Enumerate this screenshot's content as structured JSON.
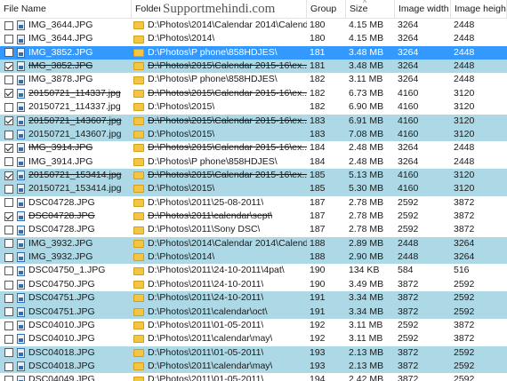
{
  "watermark": "Supportmehindi.com",
  "columns": {
    "name": "File Name",
    "folder": "Folder",
    "group": "Group",
    "size": "Size",
    "width": "Image width",
    "height": "Image height"
  },
  "sort_indicator": "^",
  "rows": [
    {
      "name": "IMG_3644.JPG",
      "folder": "D:\\Photos\\2014\\Calendar 2014\\Calendar...",
      "group": "180",
      "size": "4.15 MB",
      "width": "3264",
      "height": "2448",
      "checked": false,
      "strike": false,
      "style": "plain"
    },
    {
      "name": "IMG_3644.JPG",
      "folder": "D:\\Photos\\2014\\",
      "group": "180",
      "size": "4.15 MB",
      "width": "3264",
      "height": "2448",
      "checked": false,
      "strike": false,
      "style": "plain"
    },
    {
      "name": "IMG_3852.JPG",
      "folder": "D:\\Photos\\P phone\\858HDJES\\",
      "group": "181",
      "size": "3.48 MB",
      "width": "3264",
      "height": "2448",
      "checked": false,
      "strike": false,
      "style": "sel"
    },
    {
      "name": "IMG_3852.JPG",
      "folder": "D:\\Photos\\2015\\Calendar 2015-16\\ex...",
      "group": "181",
      "size": "3.48 MB",
      "width": "3264",
      "height": "2448",
      "checked": true,
      "strike": true,
      "style": "alt"
    },
    {
      "name": "IMG_3878.JPG",
      "folder": "D:\\Photos\\P phone\\858HDJES\\",
      "group": "182",
      "size": "3.11 MB",
      "width": "3264",
      "height": "2448",
      "checked": false,
      "strike": false,
      "style": "plain"
    },
    {
      "name": "20150721_114337.jpg",
      "folder": "D:\\Photos\\2015\\Calendar 2015-16\\ex...",
      "group": "182",
      "size": "6.73 MB",
      "width": "4160",
      "height": "3120",
      "checked": true,
      "strike": true,
      "style": "plain"
    },
    {
      "name": "20150721_114337.jpg",
      "folder": "D:\\Photos\\2015\\",
      "group": "182",
      "size": "6.90 MB",
      "width": "4160",
      "height": "3120",
      "checked": false,
      "strike": false,
      "style": "plain"
    },
    {
      "name": "20150721_143607.jpg",
      "folder": "D:\\Photos\\2015\\Calendar 2015-16\\ex...",
      "group": "183",
      "size": "6.91 MB",
      "width": "4160",
      "height": "3120",
      "checked": true,
      "strike": true,
      "style": "alt"
    },
    {
      "name": "20150721_143607.jpg",
      "folder": "D:\\Photos\\2015\\",
      "group": "183",
      "size": "7.08 MB",
      "width": "4160",
      "height": "3120",
      "checked": false,
      "strike": false,
      "style": "alt"
    },
    {
      "name": "IMG_3914.JPG",
      "folder": "D:\\Photos\\2015\\Calendar 2015-16\\ex...",
      "group": "184",
      "size": "2.48 MB",
      "width": "3264",
      "height": "2448",
      "checked": true,
      "strike": true,
      "style": "plain"
    },
    {
      "name": "IMG_3914.JPG",
      "folder": "D:\\Photos\\P phone\\858HDJES\\",
      "group": "184",
      "size": "2.48 MB",
      "width": "3264",
      "height": "2448",
      "checked": false,
      "strike": false,
      "style": "plain"
    },
    {
      "name": "20150721_153414.jpg",
      "folder": "D:\\Photos\\2015\\Calendar 2015-16\\ex...",
      "group": "185",
      "size": "5.13 MB",
      "width": "4160",
      "height": "3120",
      "checked": true,
      "strike": true,
      "style": "alt"
    },
    {
      "name": "20150721_153414.jpg",
      "folder": "D:\\Photos\\2015\\",
      "group": "185",
      "size": "5.30 MB",
      "width": "4160",
      "height": "3120",
      "checked": false,
      "strike": false,
      "style": "alt"
    },
    {
      "name": "DSC04728.JPG",
      "folder": "D:\\Photos\\2011\\25-08-2011\\",
      "group": "187",
      "size": "2.78 MB",
      "width": "2592",
      "height": "3872",
      "checked": false,
      "strike": false,
      "style": "plain"
    },
    {
      "name": "DSC04728.JPG",
      "folder": "D:\\Photos\\2011\\calendar\\sept\\",
      "group": "187",
      "size": "2.78 MB",
      "width": "2592",
      "height": "3872",
      "checked": true,
      "strike": true,
      "style": "plain"
    },
    {
      "name": "DSC04728.JPG",
      "folder": "D:\\Photos\\2011\\Sony DSC\\",
      "group": "187",
      "size": "2.78 MB",
      "width": "2592",
      "height": "3872",
      "checked": false,
      "strike": false,
      "style": "plain"
    },
    {
      "name": "IMG_3932.JPG",
      "folder": "D:\\Photos\\2014\\Calendar 2014\\Calend...",
      "group": "188",
      "size": "2.89 MB",
      "width": "2448",
      "height": "3264",
      "checked": false,
      "strike": false,
      "style": "alt"
    },
    {
      "name": "IMG_3932.JPG",
      "folder": "D:\\Photos\\2014\\",
      "group": "188",
      "size": "2.90 MB",
      "width": "2448",
      "height": "3264",
      "checked": false,
      "strike": false,
      "style": "alt"
    },
    {
      "name": "DSC04750_1.JPG",
      "folder": "D:\\Photos\\2011\\24-10-2011\\4pat\\",
      "group": "190",
      "size": "134 KB",
      "width": "584",
      "height": "516",
      "checked": false,
      "strike": false,
      "style": "plain"
    },
    {
      "name": "DSC04750.JPG",
      "folder": "D:\\Photos\\2011\\24-10-2011\\",
      "group": "190",
      "size": "3.49 MB",
      "width": "3872",
      "height": "2592",
      "checked": false,
      "strike": false,
      "style": "plain"
    },
    {
      "name": "DSC04751.JPG",
      "folder": "D:\\Photos\\2011\\24-10-2011\\",
      "group": "191",
      "size": "3.34 MB",
      "width": "3872",
      "height": "2592",
      "checked": false,
      "strike": false,
      "style": "alt"
    },
    {
      "name": "DSC04751.JPG",
      "folder": "D:\\Photos\\2011\\calendar\\oct\\",
      "group": "191",
      "size": "3.34 MB",
      "width": "3872",
      "height": "2592",
      "checked": false,
      "strike": false,
      "style": "alt"
    },
    {
      "name": "DSC04010.JPG",
      "folder": "D:\\Photos\\2011\\01-05-2011\\",
      "group": "192",
      "size": "3.11 MB",
      "width": "2592",
      "height": "3872",
      "checked": false,
      "strike": false,
      "style": "plain"
    },
    {
      "name": "DSC04010.JPG",
      "folder": "D:\\Photos\\2011\\calendar\\may\\",
      "group": "192",
      "size": "3.11 MB",
      "width": "2592",
      "height": "3872",
      "checked": false,
      "strike": false,
      "style": "plain"
    },
    {
      "name": "DSC04018.JPG",
      "folder": "D:\\Photos\\2011\\01-05-2011\\",
      "group": "193",
      "size": "2.13 MB",
      "width": "3872",
      "height": "2592",
      "checked": false,
      "strike": false,
      "style": "alt"
    },
    {
      "name": "DSC04018.JPG",
      "folder": "D:\\Photos\\2011\\calendar\\may\\",
      "group": "193",
      "size": "2.13 MB",
      "width": "3872",
      "height": "2592",
      "checked": false,
      "strike": false,
      "style": "alt"
    },
    {
      "name": "DSC04049.JPG",
      "folder": "D:\\Photos\\2011\\01-05-2011\\",
      "group": "194",
      "size": "2.42 MB",
      "width": "3872",
      "height": "2592",
      "checked": false,
      "strike": false,
      "style": "plain"
    }
  ],
  "colors": {
    "alt_row": "#add8e6",
    "selected_row": "#3399ff",
    "folder_icon": "#f4c542"
  }
}
